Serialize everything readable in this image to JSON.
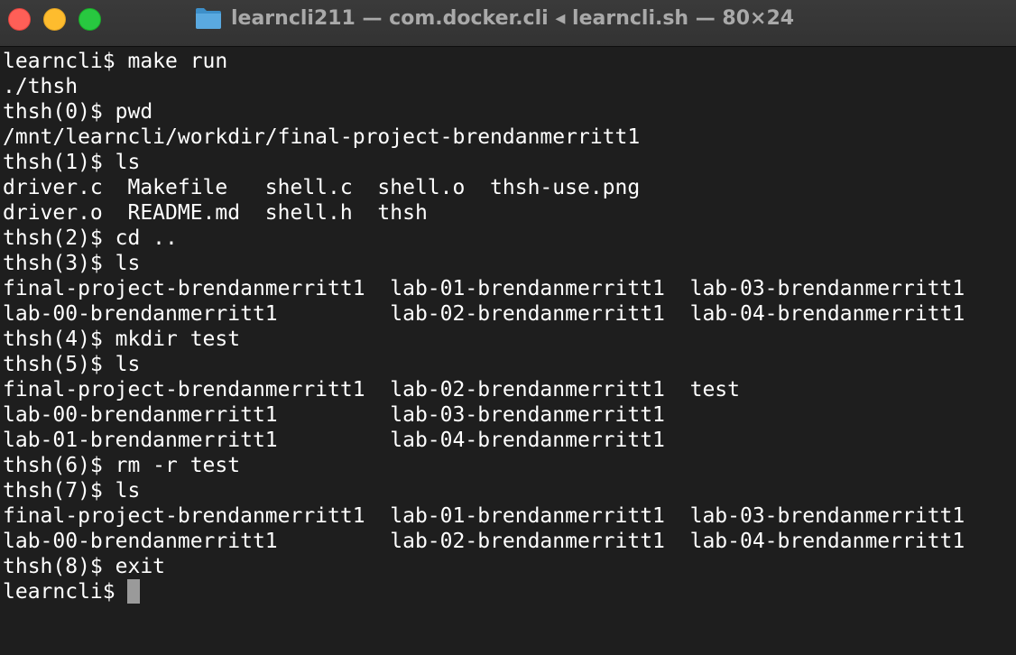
{
  "window": {
    "title": "learncli211 — com.docker.cli ◂ learncli.sh — 80×24",
    "folder_icon": "folder-icon",
    "traffic_lights": {
      "close": "#fe5f57",
      "minimize": "#febc2e",
      "maximize": "#28c840"
    }
  },
  "terminal": {
    "background": "#1e1e1e",
    "foreground": "#ffffff",
    "lines": [
      "learncli$ make run",
      "./thsh",
      "thsh(0)$ pwd",
      "/mnt/learncli/workdir/final-project-brendanmerritt1",
      "thsh(1)$ ls",
      "driver.c  Makefile   shell.c  shell.o  thsh-use.png",
      "driver.o  README.md  shell.h  thsh",
      "thsh(2)$ cd ..",
      "thsh(3)$ ls",
      "final-project-brendanmerritt1  lab-01-brendanmerritt1  lab-03-brendanmerritt1",
      "lab-00-brendanmerritt1         lab-02-brendanmerritt1  lab-04-brendanmerritt1",
      "thsh(4)$ mkdir test",
      "thsh(5)$ ls",
      "final-project-brendanmerritt1  lab-02-brendanmerritt1  test",
      "lab-00-brendanmerritt1         lab-03-brendanmerritt1",
      "lab-01-brendanmerritt1         lab-04-brendanmerritt1",
      "thsh(6)$ rm -r test",
      "thsh(7)$ ls",
      "final-project-brendanmerritt1  lab-01-brendanmerritt1  lab-03-brendanmerritt1",
      "lab-00-brendanmerritt1         lab-02-brendanmerritt1  lab-04-brendanmerritt1",
      "thsh(8)$ exit"
    ],
    "prompt": "learncli$ "
  }
}
